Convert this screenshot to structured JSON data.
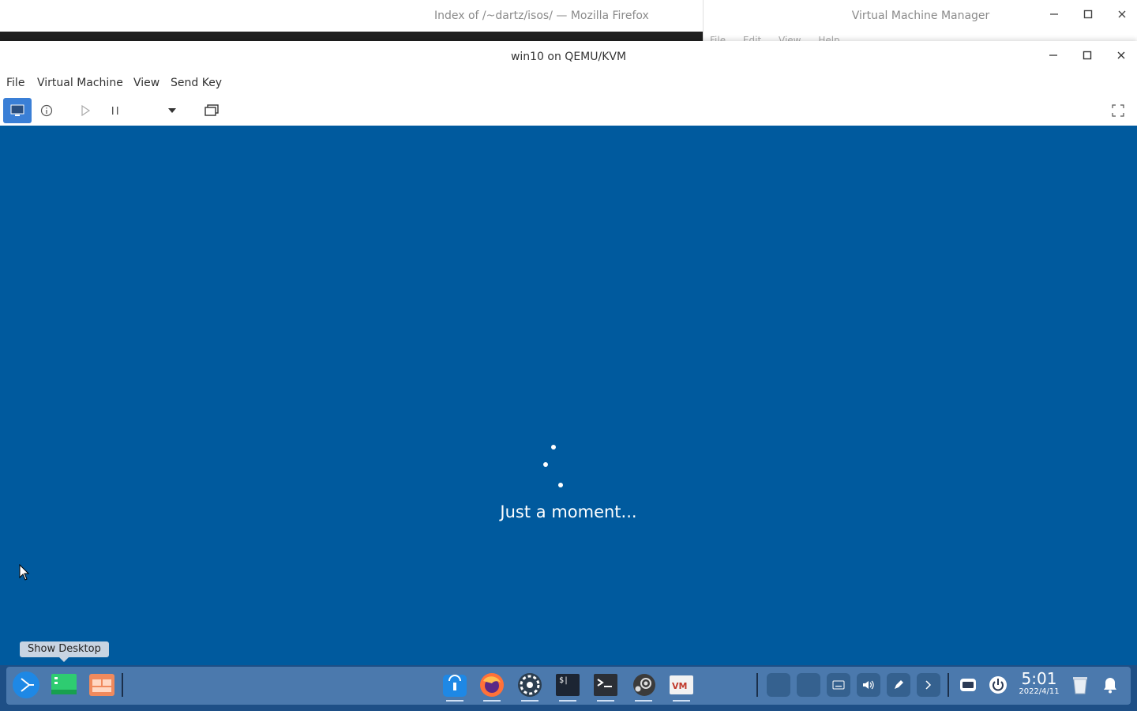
{
  "background_windows": {
    "firefox_title": "Index of /~dartz/isos/ — Mozilla Firefox",
    "vmm_title": "Virtual Machine Manager",
    "vmm_menu": [
      "File",
      "Edit",
      "View",
      "Help"
    ]
  },
  "window": {
    "title": "win10 on QEMU/KVM",
    "menu": [
      "File",
      "Virtual Machine",
      "View",
      "Send Key"
    ]
  },
  "guest": {
    "status_text": "Just a moment...",
    "background_color": "#005a9e"
  },
  "tooltip": "Show Desktop",
  "taskbar": {
    "time": "5:01",
    "date": "2022/4/11"
  }
}
